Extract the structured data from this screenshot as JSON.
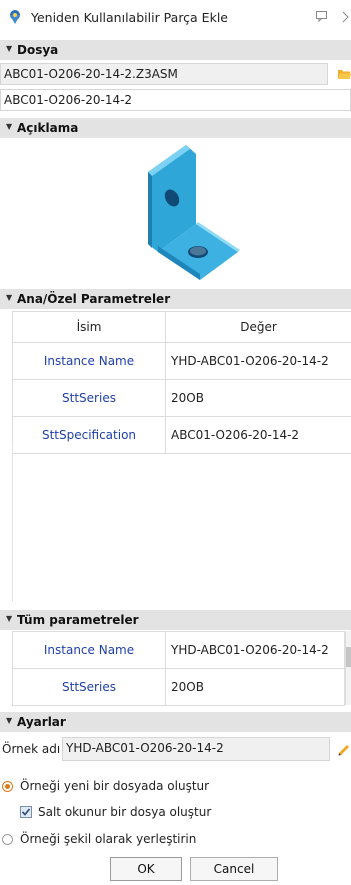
{
  "window": {
    "title": "Yeniden Kullanılabilir Parça Ekle"
  },
  "file_section": {
    "header": "Dosya",
    "path_value": "ABC01-O206-20-14-2.Z3ASM",
    "name_value": "ABC01-O206-20-14-2"
  },
  "description_section": {
    "header": "Açıklama"
  },
  "params_section": {
    "header": "Ana/Özel Parametreler",
    "columns": [
      "İsim",
      "Değer"
    ],
    "rows": [
      {
        "name": "Instance Name",
        "value": "YHD-ABC01-O206-20-14-2"
      },
      {
        "name": "SttSeries",
        "value": "20OB"
      },
      {
        "name": "SttSpecification",
        "value": "ABC01-O206-20-14-2"
      }
    ]
  },
  "all_params_section": {
    "header": "Tüm parametreler",
    "rows": [
      {
        "name": "Instance Name",
        "value": "YHD-ABC01-O206-20-14-2"
      },
      {
        "name": "SttSeries",
        "value": "20OB"
      }
    ]
  },
  "settings_section": {
    "header": "Ayarlar",
    "instance_label": "Örnek adı",
    "instance_value": "YHD-ABC01-O206-20-14-2",
    "option_new_file": "Örneği yeni bir dosyada oluştur",
    "option_readonly": "Salt okunur bir dosya oluştur",
    "option_place_shape": "Örneği şekil olarak yerleştirin"
  },
  "buttons": {
    "ok": "OK",
    "cancel": "Cancel"
  },
  "colors": {
    "accent_orange": "#e07818",
    "link_blue": "#1f3fa8",
    "part_blue": "#2fa6d8"
  }
}
